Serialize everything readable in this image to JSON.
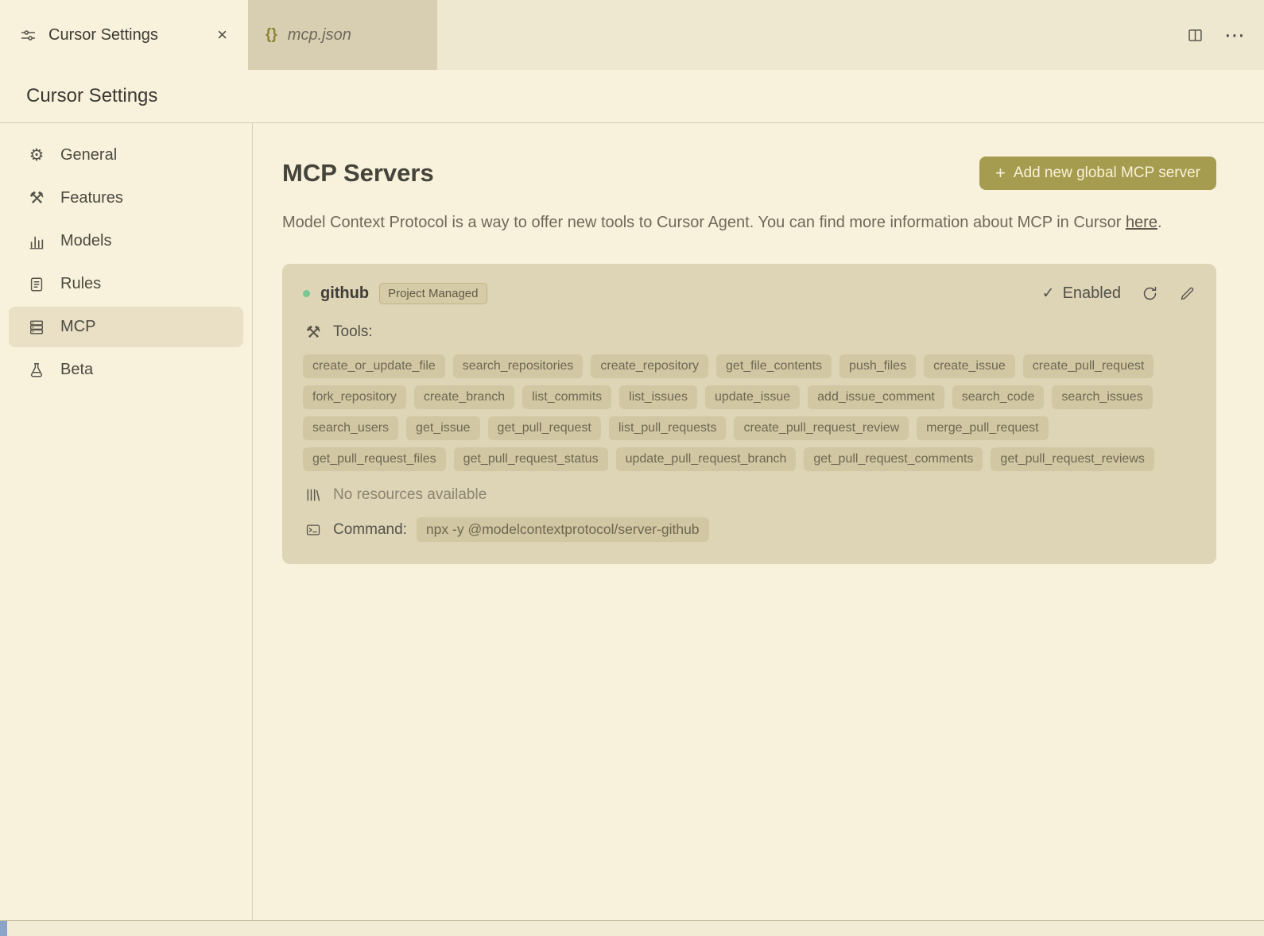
{
  "tabs": {
    "settings": {
      "label": "Cursor Settings"
    },
    "json": {
      "label": "mcp.json"
    }
  },
  "header": {
    "title": "Cursor Settings"
  },
  "sidebar": {
    "items": [
      {
        "label": "General",
        "icon": "gear",
        "active": false
      },
      {
        "label": "Features",
        "icon": "tools",
        "active": false
      },
      {
        "label": "Models",
        "icon": "bar-chart",
        "active": false
      },
      {
        "label": "Rules",
        "icon": "document",
        "active": false
      },
      {
        "label": "MCP",
        "icon": "server",
        "active": true
      },
      {
        "label": "Beta",
        "icon": "flask",
        "active": false
      }
    ]
  },
  "main": {
    "title": "MCP Servers",
    "add_button_label": "Add new global MCP server",
    "description": "Model Context Protocol is a way to offer new tools to Cursor Agent. You can find more information about MCP in Cursor",
    "description_link": "here",
    "description_suffix": ".",
    "server": {
      "name": "github",
      "badge": "Project Managed",
      "status": "Enabled",
      "tools_label": "Tools:",
      "tools": [
        "create_or_update_file",
        "search_repositories",
        "create_repository",
        "get_file_contents",
        "push_files",
        "create_issue",
        "create_pull_request",
        "fork_repository",
        "create_branch",
        "list_commits",
        "list_issues",
        "update_issue",
        "add_issue_comment",
        "search_code",
        "search_issues",
        "search_users",
        "get_issue",
        "get_pull_request",
        "list_pull_requests",
        "create_pull_request_review",
        "merge_pull_request",
        "get_pull_request_files",
        "get_pull_request_status",
        "update_pull_request_branch",
        "get_pull_request_comments",
        "get_pull_request_reviews"
      ],
      "resources_text": "No resources available",
      "command_label": "Command:",
      "command": "npx -y @modelcontextprotocol/server-github"
    }
  },
  "colors": {
    "accent_button": "#a59c4f",
    "status_dot": "#79c795",
    "card_background": "#ded4b6"
  }
}
